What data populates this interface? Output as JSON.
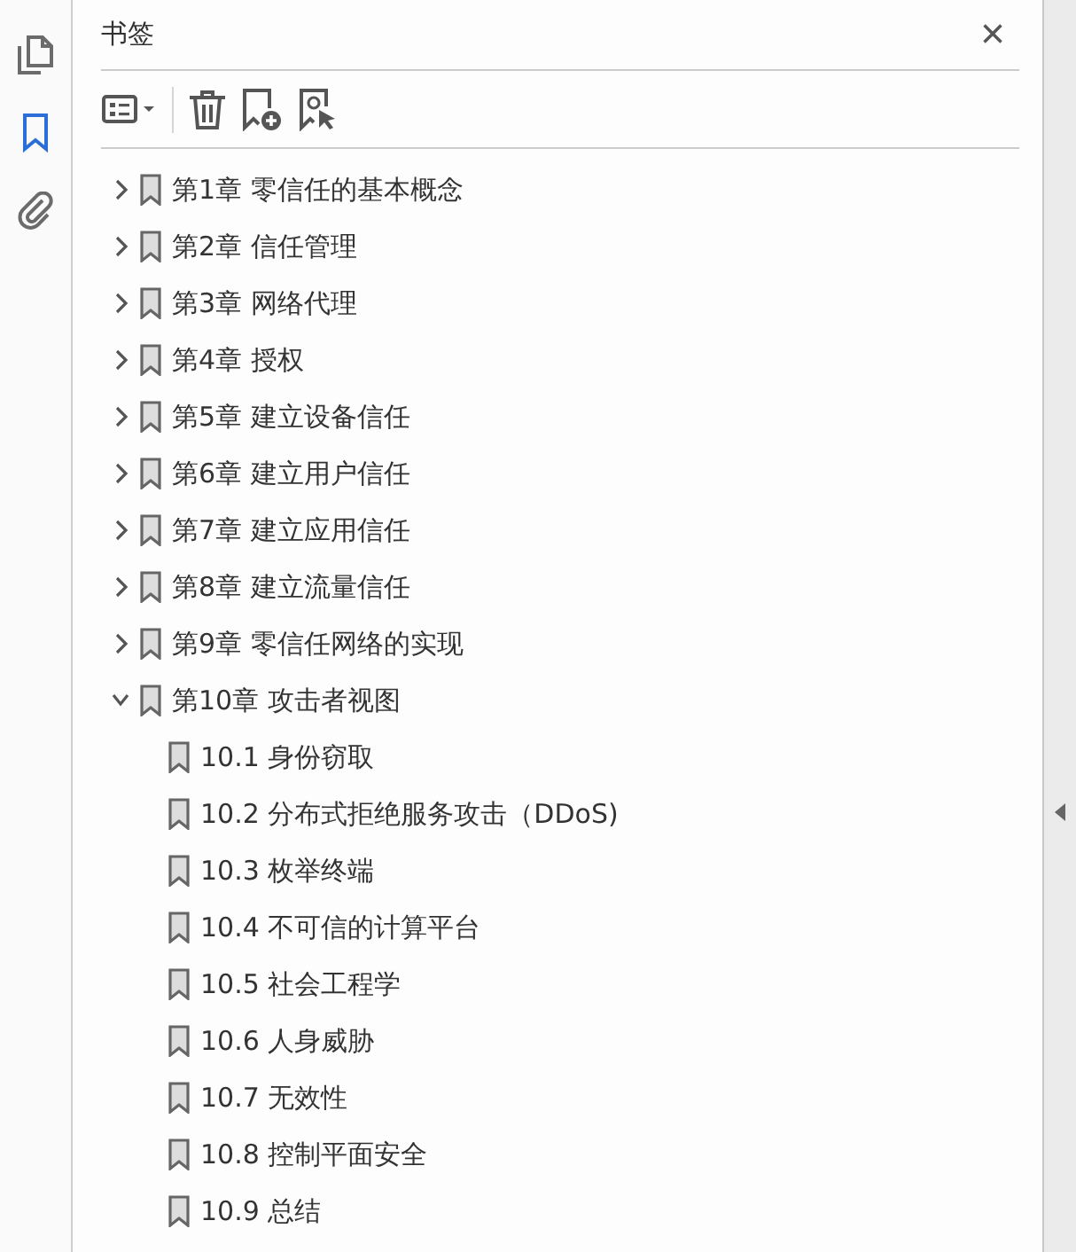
{
  "rail": {
    "items": [
      {
        "kind": "pages",
        "selected": false
      },
      {
        "kind": "bookmarks",
        "selected": true
      },
      {
        "kind": "attachments",
        "selected": false
      }
    ]
  },
  "panel": {
    "title": "书签",
    "close": "×"
  },
  "bookmarks": [
    {
      "label": "第1章  零信任的基本概念",
      "expanded": false
    },
    {
      "label": "第2章  信任管理",
      "expanded": false
    },
    {
      "label": "第3章  网络代理",
      "expanded": false
    },
    {
      "label": "第4章  授权",
      "expanded": false
    },
    {
      "label": "第5章  建立设备信任",
      "expanded": false
    },
    {
      "label": "第6章  建立用户信任",
      "expanded": false
    },
    {
      "label": "第7章  建立应用信任",
      "expanded": false
    },
    {
      "label": "第8章  建立流量信任",
      "expanded": false
    },
    {
      "label": "第9章  零信任网络的实现",
      "expanded": false
    },
    {
      "label": "第10章  攻击者视图",
      "expanded": true,
      "children": [
        {
          "label": "10.1  身份窃取"
        },
        {
          "label": "10.2  分布式拒绝服务攻击（DDoS)"
        },
        {
          "label": "10.3  枚举终端"
        },
        {
          "label": "10.4  不可信的计算平台"
        },
        {
          "label": "10.5  社会工程学"
        },
        {
          "label": "10.6  人身威胁"
        },
        {
          "label": "10.7  无效性"
        },
        {
          "label": "10.8  控制平面安全"
        },
        {
          "label": "10.9  总结"
        }
      ]
    }
  ]
}
